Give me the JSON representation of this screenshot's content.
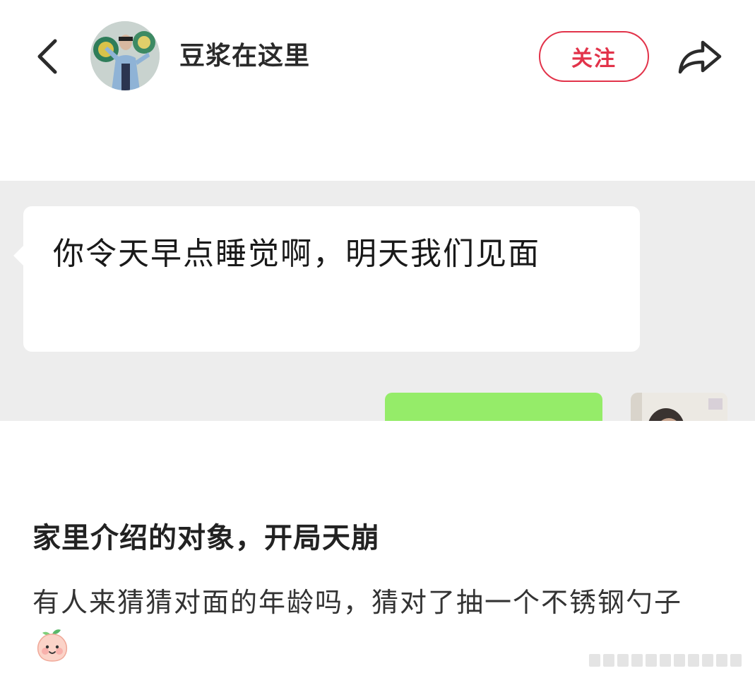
{
  "header": {
    "username": "豆浆在这里",
    "follow_label": "关注"
  },
  "chat_image": {
    "received_message": "你令天早点睡觉啊，明天我们见面"
  },
  "post": {
    "title": "家里介绍的对象，开局天崩",
    "body": "有人来猜猜对面的年龄吗，猜对了抽一个不锈钢勺子"
  },
  "icons": {
    "back": "chevron-left-icon",
    "share": "share-arrow-icon",
    "emoji": "peach-face-emoji-icon"
  },
  "colors": {
    "accent": "#e2334a",
    "chat_background": "#ededed",
    "sent_bubble": "#95ec69"
  }
}
